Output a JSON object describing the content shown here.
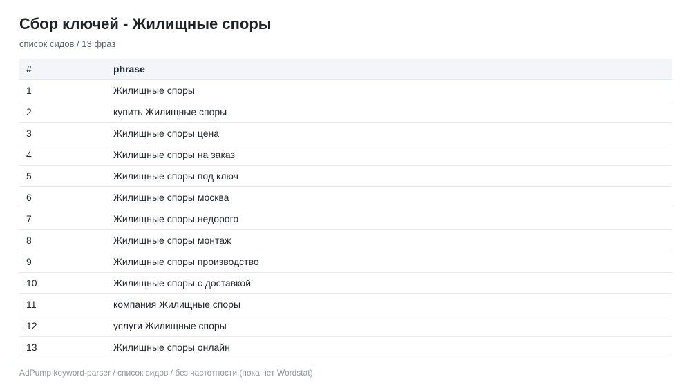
{
  "header": {
    "title": "Сбор ключей - Жилищные споры",
    "subtitle": "список сидов / 13 фраз"
  },
  "table": {
    "columns": [
      "#",
      "phrase"
    ],
    "rows": [
      {
        "num": "1",
        "phrase": "Жилищные споры"
      },
      {
        "num": "2",
        "phrase": "купить Жилищные споры"
      },
      {
        "num": "3",
        "phrase": "Жилищные споры цена"
      },
      {
        "num": "4",
        "phrase": "Жилищные споры на заказ"
      },
      {
        "num": "5",
        "phrase": "Жилищные споры под ключ"
      },
      {
        "num": "6",
        "phrase": "Жилищные споры москва"
      },
      {
        "num": "7",
        "phrase": "Жилищные споры недорого"
      },
      {
        "num": "8",
        "phrase": "Жилищные споры монтаж"
      },
      {
        "num": "9",
        "phrase": "Жилищные споры производство"
      },
      {
        "num": "10",
        "phrase": "Жилищные споры с доставкой"
      },
      {
        "num": "11",
        "phrase": "компания Жилищные споры"
      },
      {
        "num": "12",
        "phrase": "услуги Жилищные споры"
      },
      {
        "num": "13",
        "phrase": "Жилищные споры онлайн"
      }
    ]
  },
  "footer": {
    "text": "AdPump keyword-parser / список сидов / без частотности (пока нет Wordstat)"
  }
}
